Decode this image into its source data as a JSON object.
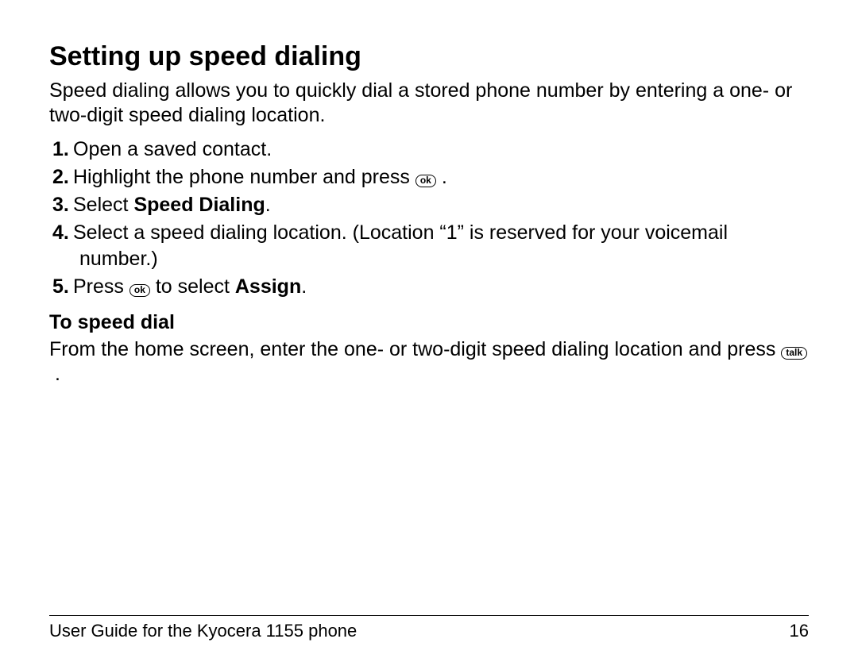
{
  "title": "Setting up speed dialing",
  "intro": "Speed dialing allows you to quickly dial a stored phone number by entering a one- or two-digit speed dialing location.",
  "steps": {
    "n1": "1.",
    "s1": "Open a saved contact.",
    "n2": "2.",
    "s2a": "Highlight the phone number and press ",
    "s2b": ".",
    "n3": "3.",
    "s3a": "Select ",
    "s3b": "Speed Dialing",
    "s3c": ".",
    "n4": "4.",
    "s4": "Select a speed dialing location. (Location “1” is reserved for your voicemail number.)",
    "n5": "5.",
    "s5a": "Press ",
    "s5b": " to select ",
    "s5c": "Assign",
    "s5d": "."
  },
  "keys": {
    "ok": "ok",
    "talk": "talk"
  },
  "sub": {
    "heading": "To speed dial",
    "body_a": "From the home screen, enter the one- or two-digit speed dialing location and press ",
    "body_b": "."
  },
  "footer": {
    "left": "User Guide for the Kyocera 1155 phone",
    "right": "16"
  }
}
